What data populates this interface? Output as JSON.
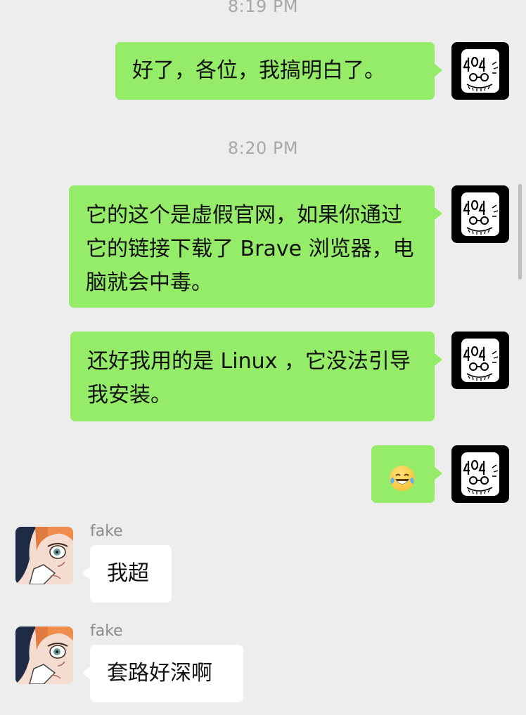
{
  "conversation": {
    "timestamps": [
      "8:19 PM",
      "8:20 PM"
    ],
    "messages": [
      {
        "sender": "me",
        "text": "好了，各位，我搞明白了。"
      },
      {
        "sender": "me",
        "text": "它的这个是虚假官网，如果你通过它的链接下载了 Brave 浏览器，电脑就会中毒。"
      },
      {
        "sender": "me",
        "text": "还好我用的是 Linux ，它没法引导我安装。"
      },
      {
        "sender": "me",
        "emoji": "face-with-tears-of-joy"
      },
      {
        "sender": "fake",
        "name": "fake",
        "text": "我超"
      },
      {
        "sender": "fake",
        "name": "fake",
        "text": "套路好深啊"
      }
    ]
  },
  "my_avatar": {
    "label": "404",
    "icon": "avatar-404-sketch-face"
  },
  "other_avatar": {
    "icon": "anime-character-avatar"
  },
  "colors": {
    "background": "#ededed",
    "outgoing_bubble": "#95ec69",
    "incoming_bubble": "#ffffff",
    "timestamp": "#a8a8a8"
  }
}
